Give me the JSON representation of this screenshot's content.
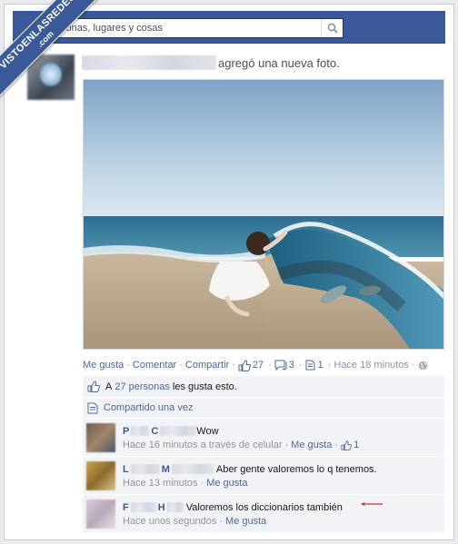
{
  "watermark": {
    "line1": "VISTOENLASREDES",
    "line2": ".com"
  },
  "search": {
    "placeholder": "sonas, lugares y cosas"
  },
  "story": {
    "action_text": "agregó una nueva foto."
  },
  "actions": {
    "like": "Me gusta",
    "comment": "Comentar",
    "share": "Compartir",
    "likes_count": "27",
    "comments_count": "3",
    "shares_count": "1",
    "time": "Hace 18 minutos",
    "separator": "·"
  },
  "ufi": {
    "likes_prefix": "A",
    "likes_link": "27 personas",
    "likes_suffix": "les gusta esto.",
    "shared_text": "Compartido una vez"
  },
  "comments": [
    {
      "name_parts": [
        "P",
        "C"
      ],
      "text": "Wow",
      "time": "Hace 16 minutos a través de celular",
      "like_label": "Me gusta",
      "like_count": "1"
    },
    {
      "name_parts": [
        "L",
        "M"
      ],
      "text": "Aber gente valoremos lo q tenemos.",
      "time": "Hace 13 minutos",
      "like_label": "Me gusta"
    },
    {
      "name_parts": [
        "F",
        "H"
      ],
      "text": "Valoremos los diccionarios también",
      "time": "Hace unos segundos",
      "like_label": "Me gusta"
    }
  ],
  "colors": {
    "facebook_blue": "#3b5998",
    "link_blue": "#4b67a1",
    "annotation_arrow": "#d0302a"
  }
}
